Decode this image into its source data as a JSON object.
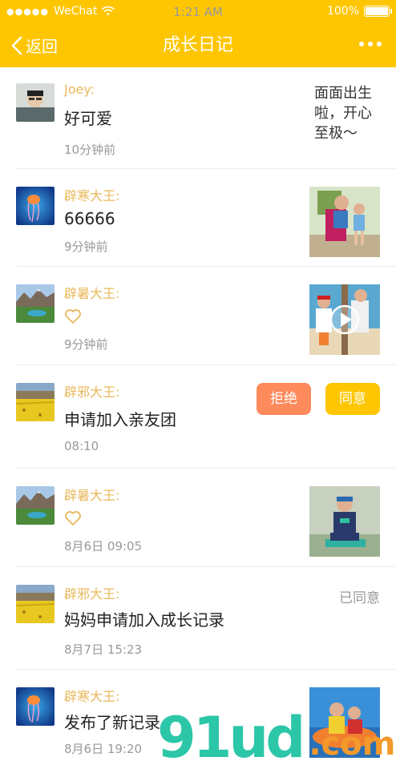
{
  "status_bar": {
    "carrier": "WeChat",
    "time": "1:21 AM",
    "battery": "100%"
  },
  "nav": {
    "back_label": "返回",
    "title": "成长日记"
  },
  "items": [
    {
      "name": "Joey:",
      "message": "好可爱",
      "time": "10分钟前",
      "side_text": "面面出生啦，开心至极～"
    },
    {
      "name": "辟寒大王:",
      "message": "66666",
      "time": "9分钟前"
    },
    {
      "name": "辟暑大王:",
      "time": "9分钟前"
    },
    {
      "name": "辟邪大王:",
      "message": "申请加入亲友团",
      "time": "08:10",
      "reject_label": "拒绝",
      "accept_label": "同意"
    },
    {
      "name": "辟暑大王:",
      "time": "8月6日   09:05"
    },
    {
      "name": "辟邪大王:",
      "message": "妈妈申请加入成长记录",
      "time": "8月7日   15:23",
      "status": "已同意"
    },
    {
      "name": "辟寒大王:",
      "message": "发布了新记录",
      "time": "8月6日   19:20"
    }
  ],
  "watermark": {
    "main": "91ud",
    "suffix": ".com"
  },
  "colors": {
    "accent": "#fec600",
    "name": "#e8b85a",
    "reject": "#ff8a5c"
  }
}
